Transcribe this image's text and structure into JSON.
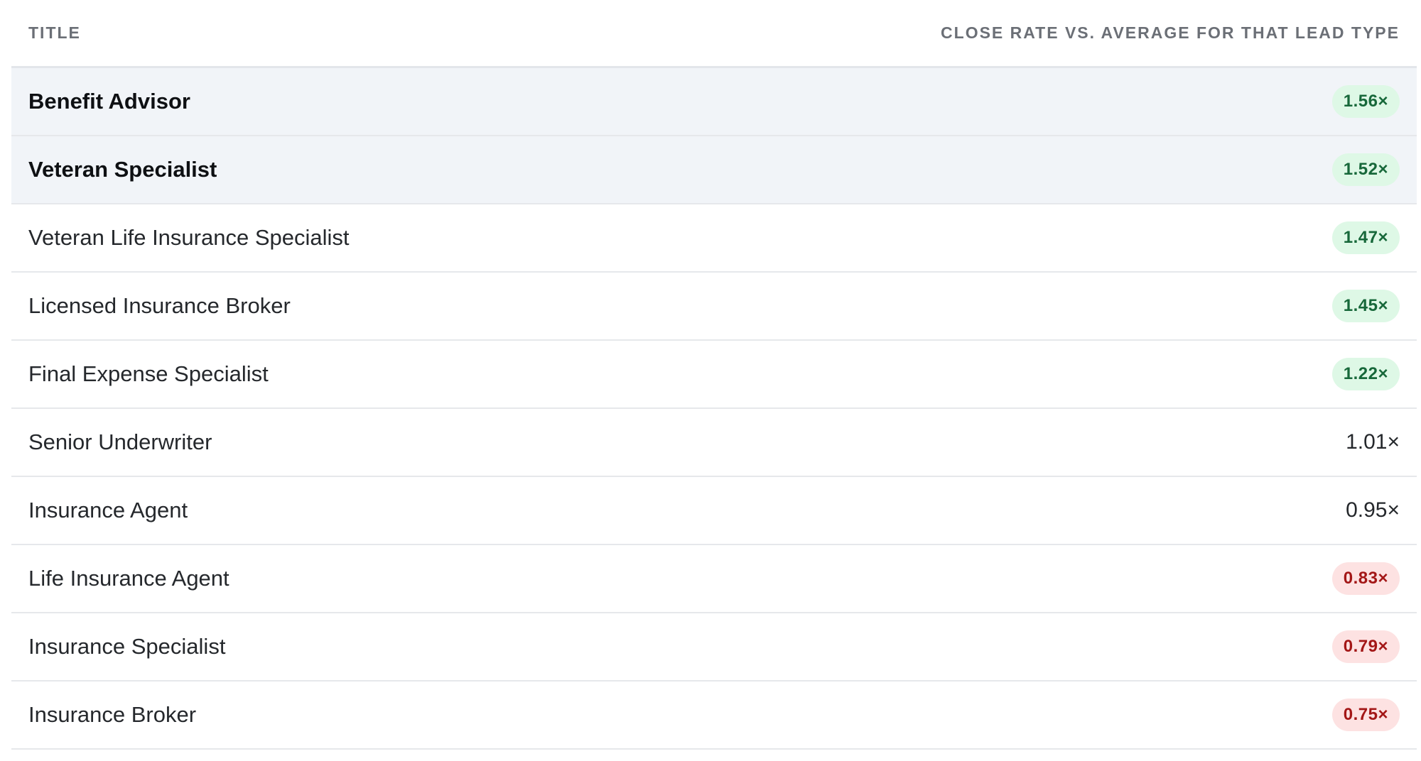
{
  "table": {
    "headers": {
      "title": "TITLE",
      "close_rate": "CLOSE RATE VS. AVERAGE FOR THAT LEAD TYPE"
    },
    "rows": [
      {
        "title": "Benefit Advisor",
        "value": "1.56×",
        "status": "good",
        "highlight": true
      },
      {
        "title": "Veteran Specialist",
        "value": "1.52×",
        "status": "good",
        "highlight": true
      },
      {
        "title": "Veteran Life Insurance Specialist",
        "value": "1.47×",
        "status": "good",
        "highlight": false
      },
      {
        "title": "Licensed Insurance Broker",
        "value": "1.45×",
        "status": "good",
        "highlight": false
      },
      {
        "title": "Final Expense Specialist",
        "value": "1.22×",
        "status": "good",
        "highlight": false
      },
      {
        "title": "Senior Underwriter",
        "value": "1.01×",
        "status": "neutral",
        "highlight": false
      },
      {
        "title": "Insurance Agent",
        "value": "0.95×",
        "status": "neutral",
        "highlight": false
      },
      {
        "title": "Life Insurance Agent",
        "value": "0.83×",
        "status": "bad",
        "highlight": false
      },
      {
        "title": "Insurance Specialist",
        "value": "0.79×",
        "status": "bad",
        "highlight": false
      },
      {
        "title": "Insurance Broker",
        "value": "0.75×",
        "status": "bad",
        "highlight": false
      }
    ]
  },
  "colors": {
    "good_bg": "#def8e6",
    "good_text": "#17683a",
    "bad_bg": "#fde2e2",
    "bad_text": "#a31717",
    "highlight_row": "#f1f4f8"
  }
}
